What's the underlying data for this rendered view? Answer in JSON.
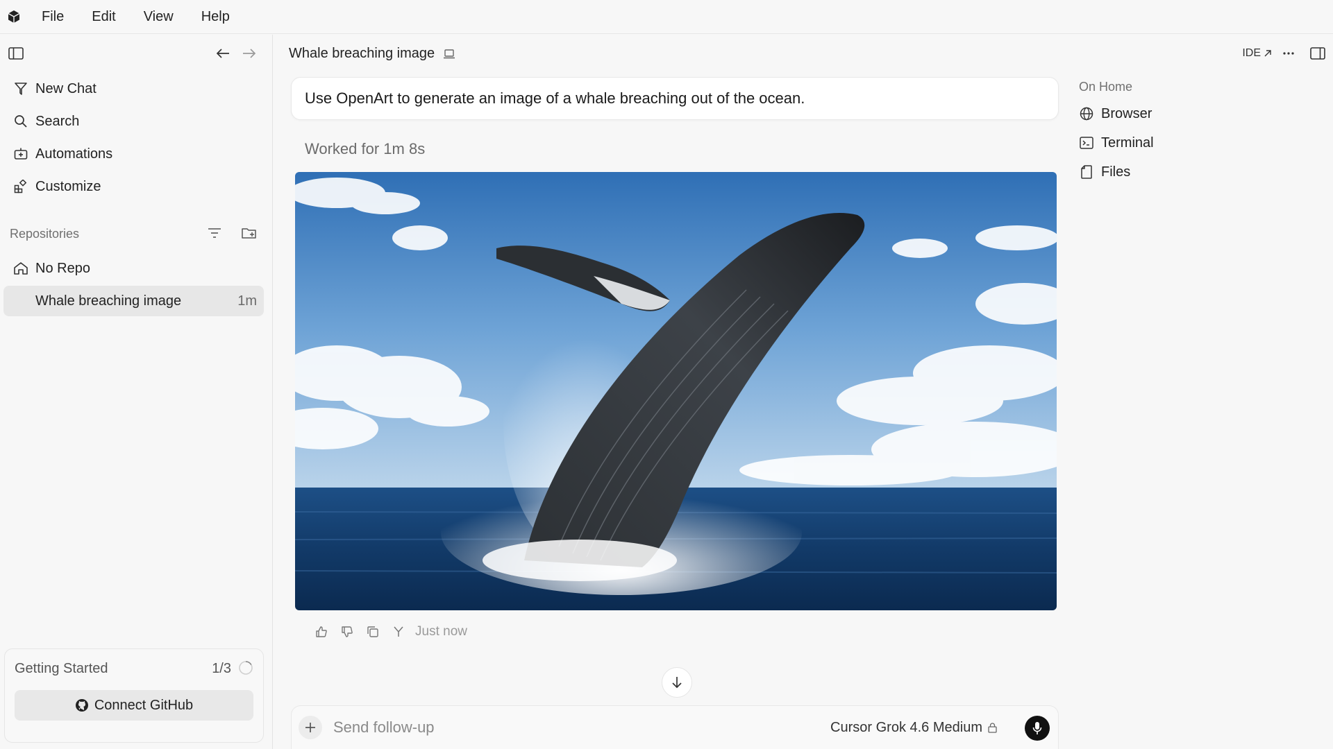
{
  "menubar": {
    "items": [
      "File",
      "Edit",
      "View",
      "Help"
    ]
  },
  "sidebar": {
    "nav": [
      {
        "label": "New Chat",
        "icon": "new-chat-icon"
      },
      {
        "label": "Search",
        "icon": "search-icon"
      },
      {
        "label": "Automations",
        "icon": "automations-icon"
      },
      {
        "label": "Customize",
        "icon": "customize-icon"
      }
    ],
    "repositories_label": "Repositories",
    "repos": [
      {
        "label": "No Repo",
        "icon": "home-icon"
      },
      {
        "label": "Whale breaching image",
        "time": "1m",
        "active": true
      }
    ],
    "getting_started": {
      "title": "Getting Started",
      "progress": "1/3",
      "button_label": "Connect GitHub"
    }
  },
  "header": {
    "chat_title": "Whale breaching image",
    "ide_label": "IDE"
  },
  "conversation": {
    "prompt": "Use OpenArt to generate an image of a whale breaching out of the ocean.",
    "worked_for": "Worked for 1m 8s",
    "timestamp": "Just now"
  },
  "composer": {
    "placeholder": "Send follow-up",
    "model": "Cursor Grok 4.6 Medium"
  },
  "right_panel": {
    "label": "On Home",
    "items": [
      {
        "label": "Browser",
        "icon": "globe-icon"
      },
      {
        "label": "Terminal",
        "icon": "terminal-icon"
      },
      {
        "label": "Files",
        "icon": "file-icon"
      }
    ]
  },
  "colors": {
    "background": "#f7f7f7",
    "active_item": "#e7e7e7",
    "mic_button": "#111111"
  }
}
